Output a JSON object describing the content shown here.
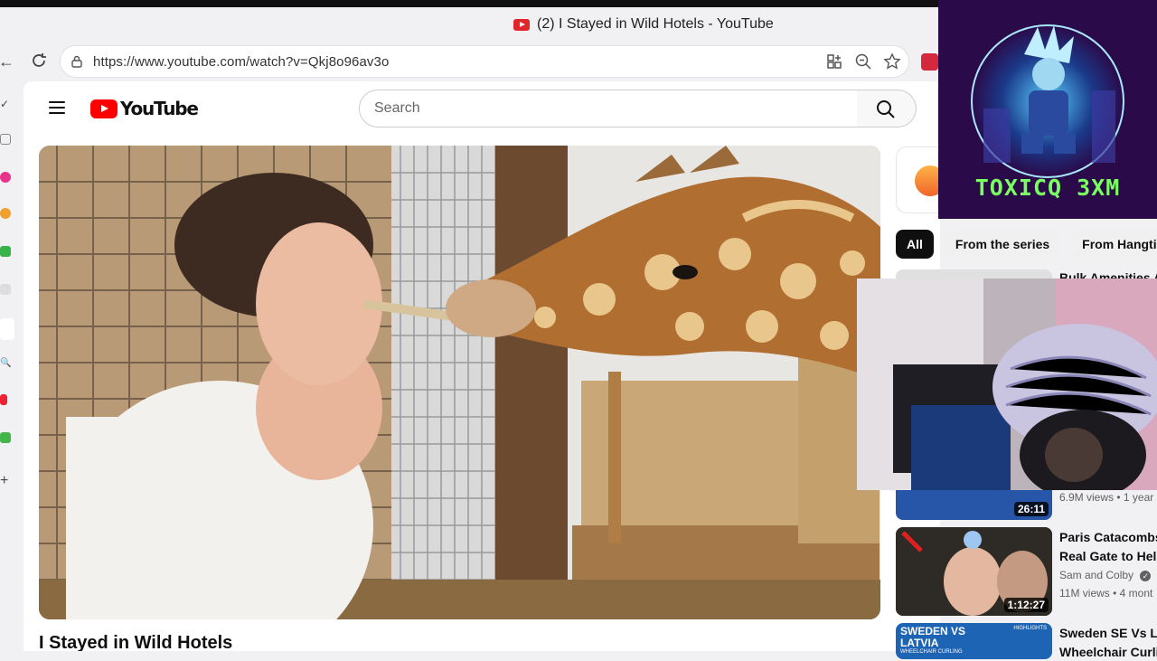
{
  "browser": {
    "tab_title": "(2) I Stayed in Wild Hotels - YouTube",
    "url": "https://www.youtube.com/watch?v=Qkj8o96av3o"
  },
  "youtube": {
    "logo_text": "YouTube",
    "search_placeholder": "Search",
    "video_title": "I Stayed in Wild Hotels",
    "chips": [
      "All",
      "From the series",
      "From Hangtime"
    ],
    "recommendations": [
      {
        "title": "Bulk Amenities A",
        "channel": "",
        "meta": "6.9M views • 1 year",
        "duration": "26:11"
      },
      {
        "title_line1": "Paris Catacombs",
        "title_line2": "Real Gate to Hell",
        "channel": "Sam and Colby",
        "meta": "11M views • 4 mont",
        "duration": "1:12:27"
      },
      {
        "title_line1": "Sweden SE Vs LV",
        "title_line2": "Wheelchair Curli",
        "thumb_line1": "SWEDEN VS",
        "thumb_line2": "LATVIA",
        "thumb_sub": "WHEELCHAIR CURLING",
        "thumb_badge": "HIGHLIGHTS"
      }
    ]
  },
  "overlay": {
    "streamer_name": "TOXICQ 3XM"
  }
}
